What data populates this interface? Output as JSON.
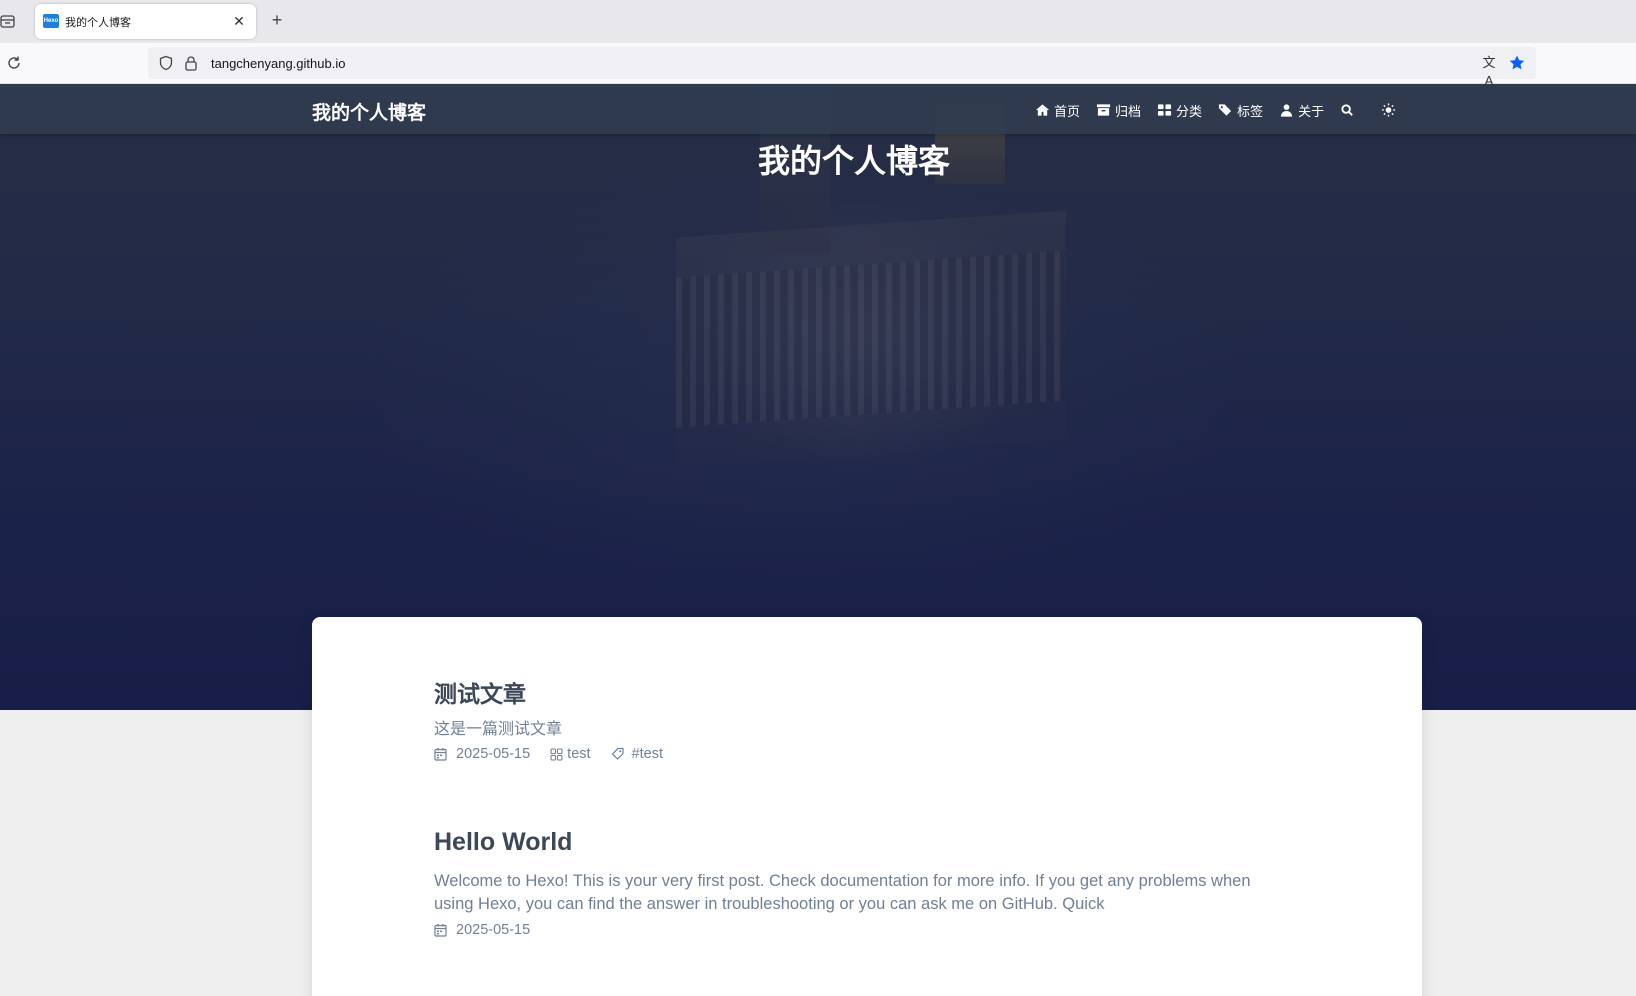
{
  "browser": {
    "tab_title": "我的个人博客",
    "favicon_text": "Hexo",
    "url": "tangchenyang.github.io"
  },
  "site": {
    "name": "我的个人博客",
    "hero_title": "我的个人博客",
    "menu": [
      {
        "label": "首页",
        "icon": "home-icon"
      },
      {
        "label": "归档",
        "icon": "archive-icon"
      },
      {
        "label": "分类",
        "icon": "categories-icon"
      },
      {
        "label": "标签",
        "icon": "tags-icon"
      },
      {
        "label": "关于",
        "icon": "user-icon"
      }
    ]
  },
  "posts": [
    {
      "title": "测试文章",
      "excerpt": "这是一篇测试文章",
      "date": "2025-05-15",
      "category": "test",
      "tag": "#test"
    },
    {
      "title": "Hello World",
      "excerpt": "Welcome to Hexo! This is your very first post. Check documentation for more info. If you get any problems when using Hexo, you can find the answer in troubleshooting or you can ask me on GitHub. Quick",
      "date": "2025-05-15"
    }
  ],
  "colors": {
    "header_bg": "#303c50",
    "hero_bg": "#1b2249",
    "title_text": "#3c4858",
    "meta_text": "#718096",
    "bookmark_star": "#0a60ff"
  }
}
